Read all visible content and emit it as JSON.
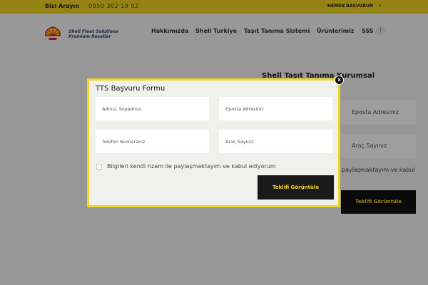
{
  "topbar": {
    "call_label": "Bizi Arayın",
    "phone": "0850 302 19 92",
    "apply_label": "HEMEN BAŞVURUN",
    "apply_icon": "chevron-right-icon"
  },
  "header": {
    "logo_icon": "shell-pecten-icon",
    "logo_line1": "Shell Fleet Solutions",
    "logo_line2": "Premium Reseller",
    "nav": [
      "Hakkımızda",
      "Shell Turkiye",
      "Taşıt Tanıma Sistemi",
      "Ürünlerimiz",
      "SSS"
    ],
    "info_icon": "info-icon"
  },
  "background": {
    "heading": "Shell Taşıt Tanıma Kurumsal",
    "field_email": "Eposta Adresiniz",
    "field_vehicles": "Araç Sayınız",
    "consent": "paylaşmaktayım ve kabul",
    "button": "Teklifi Görüntüle"
  },
  "modal": {
    "title": "TTS Başvuru Formu",
    "close_label": "x",
    "fields": {
      "name": "Adınız, Soyadınız",
      "email": "Eposta Adresiniz",
      "phone": "Telefon Numaranız",
      "vehicles": "Araç Sayınız"
    },
    "consent": "Bilgileri kendi rızam ile paylaşmaktayım ve kabul ediyorum",
    "submit": "Teklifi Görüntüle"
  },
  "colors": {
    "accent": "#f3d423",
    "dark": "#111111",
    "brand_text": "#2c3e73"
  }
}
